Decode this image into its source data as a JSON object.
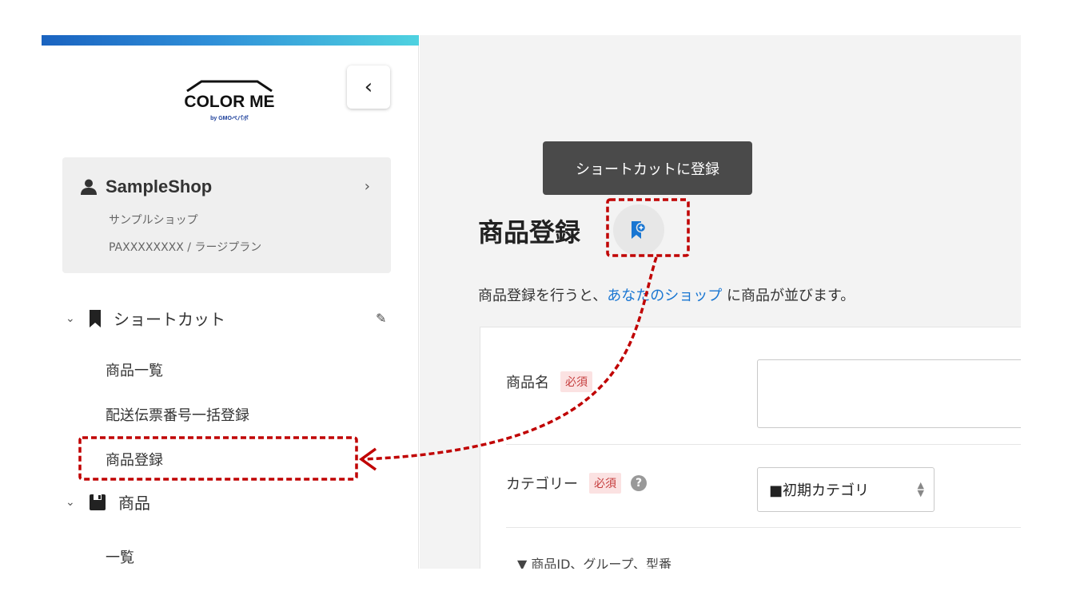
{
  "logo": {
    "word": "COLOR ME",
    "sub": "by GMOペパボ"
  },
  "shop": {
    "name": "SampleShop",
    "kana": "サンプルショップ",
    "plan": "PAXXXXXXXX / ラージプラン"
  },
  "sidebar": {
    "shortcut_section": "ショートカット",
    "shortcut_items": [
      "商品一覧",
      "配送伝票番号一括登録",
      "商品登録"
    ],
    "product_section": "商品",
    "product_items": [
      "一覧"
    ]
  },
  "main": {
    "tooltip": "ショートカットに登録",
    "page_title": "商品登録",
    "intro_before": "商品登録を行うと、",
    "intro_link": "あなたのショップ",
    "intro_after": " に商品が並びます。",
    "form": {
      "name_label": "商品名",
      "required": "必須",
      "category_label": "カテゴリー",
      "category_value": "■初期カテゴリ",
      "expander": "▼ 商品ID、グループ、型番"
    }
  },
  "colors": {
    "accent_blue": "#1976d2",
    "annotation_red": "#c00000",
    "required_bg": "#fbe2e2"
  }
}
